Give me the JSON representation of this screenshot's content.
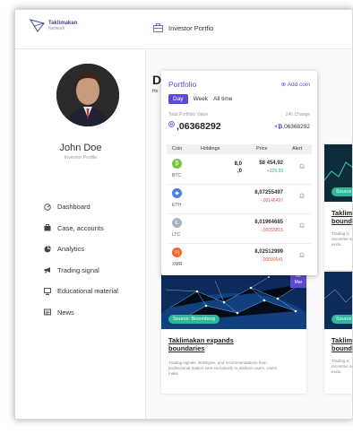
{
  "app": {
    "logo_name": "Taklimakan",
    "logo_sub": "Network"
  },
  "topbar": {
    "crumb": "Investor Portfio"
  },
  "user": {
    "name": "John Doe",
    "role": "Investor Profile"
  },
  "menu": [
    {
      "label": "Dashboard",
      "icon": "dashboard-icon"
    },
    {
      "label": "Case, accounts",
      "icon": "briefcase-icon"
    },
    {
      "label": "Analytics",
      "icon": "analytics-icon"
    },
    {
      "label": "Trading signal",
      "icon": "megaphone-icon"
    },
    {
      "label": "Educational material",
      "icon": "monitor-icon"
    },
    {
      "label": "News",
      "icon": "newspaper-icon"
    }
  ],
  "page": {
    "title_initial": "D",
    "subtitle_initial": "Ho"
  },
  "portfolio": {
    "title": "Portfolio",
    "add_coin": "⊕ Add coin",
    "tabs": [
      "Day",
      "Week",
      "All time"
    ],
    "total_label": "Total Portfolio Value",
    "change_label": "24h Change",
    "total_value": ",06368292",
    "change_value": ",06368292",
    "columns": [
      "Coin",
      "Holdings",
      "Price",
      "Alert"
    ],
    "rows": [
      {
        "symbol": "BTC",
        "holding_1": "8,0",
        "holding_2": ",0",
        "price": "$8 454,92",
        "change": "+229,93",
        "change_color": "#2bb673",
        "coin_color": "#7cc242"
      },
      {
        "symbol": "ETH",
        "holding_1": "",
        "holding_2": "",
        "price": "8,07255497",
        "change": "-,00146497",
        "change_color": "#e0524a",
        "coin_color": "#4a7fe0"
      },
      {
        "symbol": "LTC",
        "holding_1": "",
        "holding_2": "",
        "price": "8,01964685",
        "change": "-,00055815",
        "change_color": "#e0524a",
        "coin_color": "#aab1bf"
      },
      {
        "symbol": "XMR",
        "holding_1": "",
        "holding_2": "",
        "price": "8,02512999",
        "change": "-,00099541",
        "change_color": "#e0524a",
        "coin_color": "#f26822"
      }
    ]
  },
  "cards": [
    {
      "source": "Source: Bloomberg",
      "badge_day": "02",
      "badge_month": "Mar",
      "title": "Taklimakan expands boundaries",
      "text": "Trading signals, strategies, and recommendations from professional traders sent exclusively to platform users. Users make"
    },
    {
      "source": "Source",
      "title": "Taklim bound",
      "text": "Trading si recomme sent exclu"
    },
    {
      "source": "Source",
      "title": "Taklim bound",
      "text": "Trading si recomme sent exclu"
    }
  ]
}
